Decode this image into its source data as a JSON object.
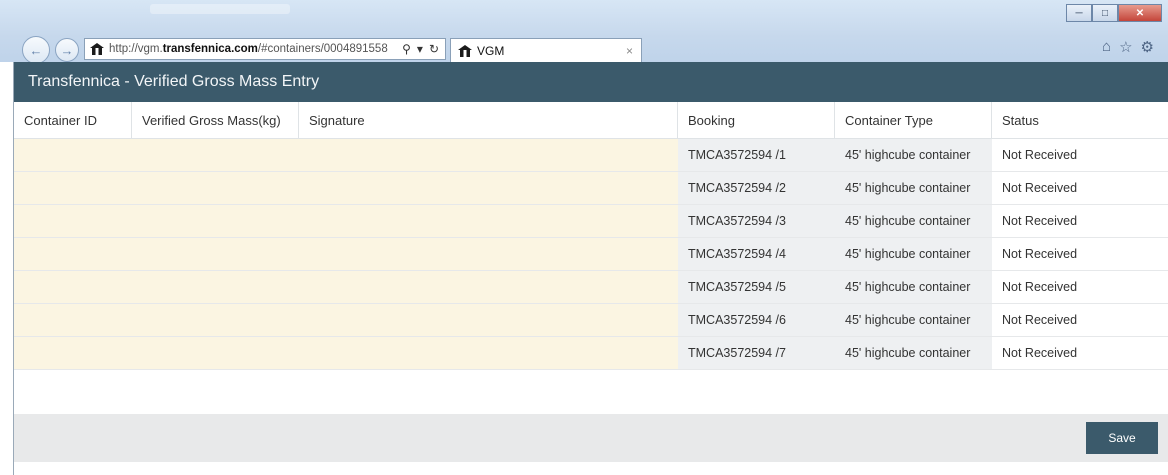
{
  "browser": {
    "url_prefix": "http://vgm.",
    "url_domain": "transfennica.com",
    "url_suffix": "/#containers/0004891558",
    "tab_title": "VGM",
    "tab_close": "×",
    "icons": [
      "back-icon",
      "forward-icon",
      "site-icon",
      "search-icon",
      "refresh-icon",
      "home-icon",
      "favorites-star-icon",
      "settings-gear-icon"
    ]
  },
  "app": {
    "title": "Transfennica - Verified Gross Mass Entry",
    "accent_color": "#3b5a6b"
  },
  "table": {
    "columns": [
      "Container ID",
      "Verified Gross Mass(kg)",
      "Signature",
      "Booking",
      "Container Type",
      "Status"
    ],
    "rows": [
      {
        "booking": "TMCA3572594 /1",
        "type": "45' highcube container",
        "status": "Not Received"
      },
      {
        "booking": "TMCA3572594 /2",
        "type": "45' highcube container",
        "status": "Not Received"
      },
      {
        "booking": "TMCA3572594 /3",
        "type": "45' highcube container",
        "status": "Not Received"
      },
      {
        "booking": "TMCA3572594 /4",
        "type": "45' highcube container",
        "status": "Not Received"
      },
      {
        "booking": "TMCA3572594 /5",
        "type": "45' highcube container",
        "status": "Not Received"
      },
      {
        "booking": "TMCA3572594 /6",
        "type": "45' highcube container",
        "status": "Not Received"
      },
      {
        "booking": "TMCA3572594 /7",
        "type": "45' highcube container",
        "status": "Not Received"
      }
    ]
  },
  "footer": {
    "save_label": "Save"
  }
}
